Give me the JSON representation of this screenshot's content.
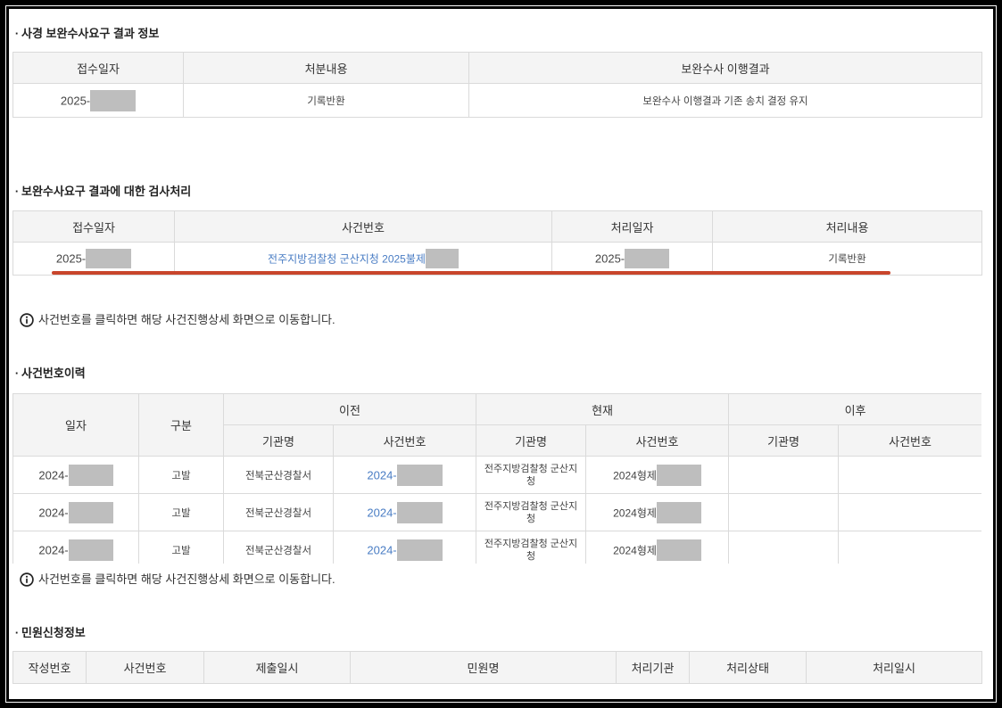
{
  "result_info": {
    "title": "사경 보완수사요구 결과 정보",
    "headers": [
      "접수일자",
      "처분내용",
      "보완수사 이행결과"
    ],
    "rows": [
      {
        "received_date": "2025-",
        "disposition": "기록반환",
        "result": "보완수사 이행결과 기존 송치 결정 유지"
      }
    ]
  },
  "prosecutor_processing": {
    "title": "보완수사요구 결과에 대한 검사처리",
    "headers": [
      "접수일자",
      "사건번호",
      "처리일자",
      "처리내용"
    ],
    "rows": [
      {
        "received_date": "2025-",
        "case_number": "전주지방검찰청 군산지청 2025불제",
        "processed_date": "2025-",
        "processing": "기록반환"
      }
    ],
    "notice": "사건번호를 클릭하면 해당 사건진행상세 화면으로 이동합니다."
  },
  "case_history": {
    "title": "사건번호이력",
    "headers": {
      "date": "일자",
      "type": "구분",
      "previous": "이전",
      "current": "현재",
      "next": "이후",
      "agency": "기관명",
      "case_number": "사건번호"
    },
    "rows": [
      {
        "date": "2024-",
        "type": "고발",
        "previous_agency": "전북군산경찰서",
        "previous_case_number": "2024-",
        "current_agency": "전주지방검찰청 군산지청",
        "current_case_number": "2024형제"
      },
      {
        "date": "2024-",
        "type": "고발",
        "previous_agency": "전북군산경찰서",
        "previous_case_number": "2024-",
        "current_agency": "전주지방검찰청 군산지청",
        "current_case_number": "2024형제"
      },
      {
        "date": "2024-",
        "type": "고발",
        "previous_agency": "전북군산경찰서",
        "previous_case_number": "2024-",
        "current_agency": "전주지방검찰청 군산지청",
        "current_case_number": "2024형제"
      }
    ],
    "notice": "사건번호를 클릭하면 해당 사건진행상세 화면으로 이동합니다."
  },
  "complaint_info": {
    "title": "민원신청정보",
    "headers": [
      "작성번호",
      "사건번호",
      "제출일시",
      "민원명",
      "처리기관",
      "처리상태",
      "처리일시"
    ]
  },
  "colors": {
    "link": "#4a7dc4",
    "redaction": "#bebebe",
    "highlight_underline": "#c8452b",
    "header_background": "#f4f4f4",
    "border": "#dadada"
  }
}
